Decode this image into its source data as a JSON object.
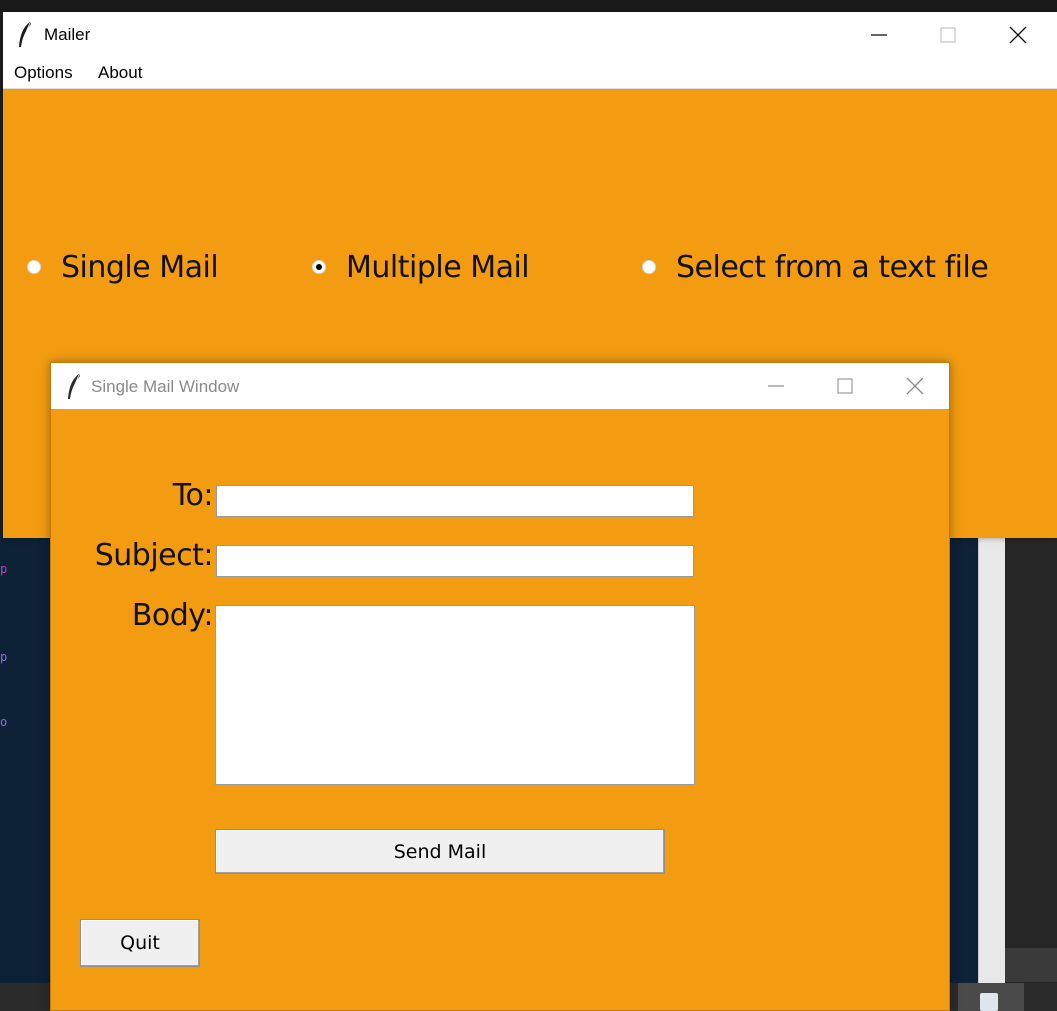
{
  "main_window": {
    "title": "Mailer",
    "menu": [
      "Options",
      "About"
    ],
    "radio_options": [
      {
        "label": "Single Mail",
        "checked": false
      },
      {
        "label": "Multiple Mail",
        "checked": true
      },
      {
        "label": "Select from a text file",
        "checked": false
      }
    ],
    "background_color": "#f39c12"
  },
  "dialog": {
    "title": "Single Mail Window",
    "fields": {
      "to_label": "To:",
      "to_value": "",
      "subject_label": "Subject:",
      "subject_value": "",
      "body_label": "Body:",
      "body_value": ""
    },
    "send_button": "Send Mail",
    "quit_button": "Quit"
  },
  "icons": {
    "app_icon": "feather-icon",
    "minimize": "minimize-icon",
    "maximize": "maximize-icon",
    "close": "close-icon"
  }
}
